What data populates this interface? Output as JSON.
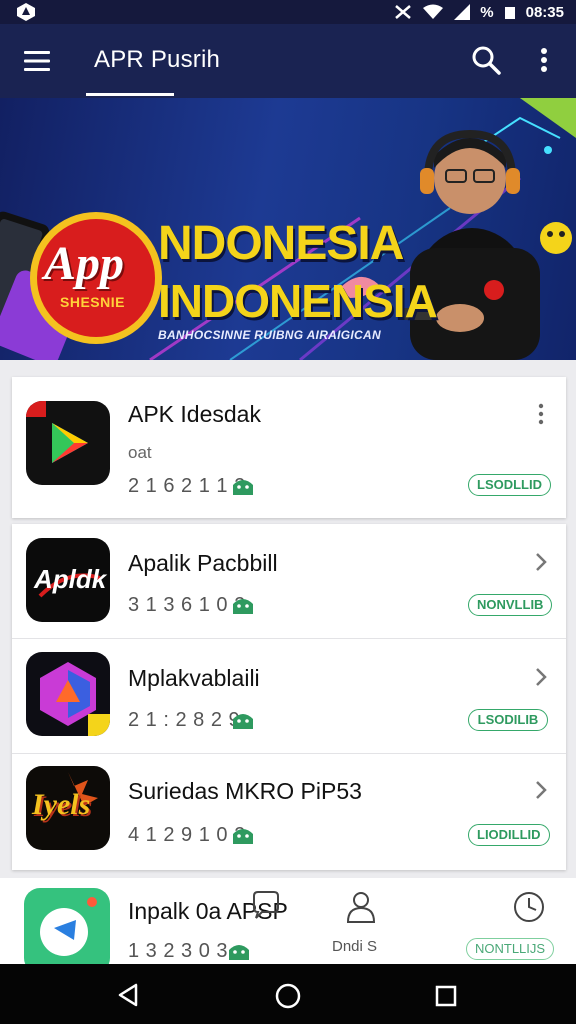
{
  "status_bar": {
    "time": "08:35",
    "battery_icon": "battery-icon",
    "wifi_icon": "wifi-icon",
    "signal_icon": "signal-icon",
    "percent": "%"
  },
  "app_bar": {
    "title": "APR Pusrih",
    "menu_icon": "menu-icon",
    "search_icon": "search-icon",
    "more_icon": "more-vert-icon"
  },
  "banner": {
    "badge_main": "App",
    "badge_sub": "SHESNIE",
    "headline_1": "NDONESIA",
    "headline_2": "INDONENSIA",
    "tagline": "BANHOCSINNE RUIBNG AIRAIGICAN"
  },
  "list": [
    {
      "name": "APK Idesdak",
      "sub": "oat",
      "number": "2 1 6 2 1 1 2",
      "pill": "LSODLLID",
      "action": "kebab"
    },
    {
      "name": "Apalik Pacbbill",
      "sub": "",
      "number": "3 1 3 6 1 0 2",
      "pill": "NONVLLIB",
      "action": "chevron"
    },
    {
      "name": "Mplakvablaili",
      "sub": "",
      "number": "2 1 : 2 8 2 9",
      "pill": "LSODILIB",
      "action": "chevron"
    },
    {
      "name": "Suriedas MKRO PiP53",
      "sub": "",
      "number": "4 1 2 9 1 0 2",
      "pill": "LIODILLID",
      "action": "chevron"
    }
  ],
  "icon_labels": {
    "apl": "Apldk",
    "game": "Iyels"
  },
  "bottom": {
    "name": "Inpalk 0a APSP",
    "number": "1 3 2 3 0 3",
    "nav_label_1": "Dndi S",
    "nav_label_2": "NONTLLIJS"
  },
  "colors": {
    "appbar": "#1a2352",
    "accent": "#f4d41a",
    "pill": "#2e9a5f"
  }
}
